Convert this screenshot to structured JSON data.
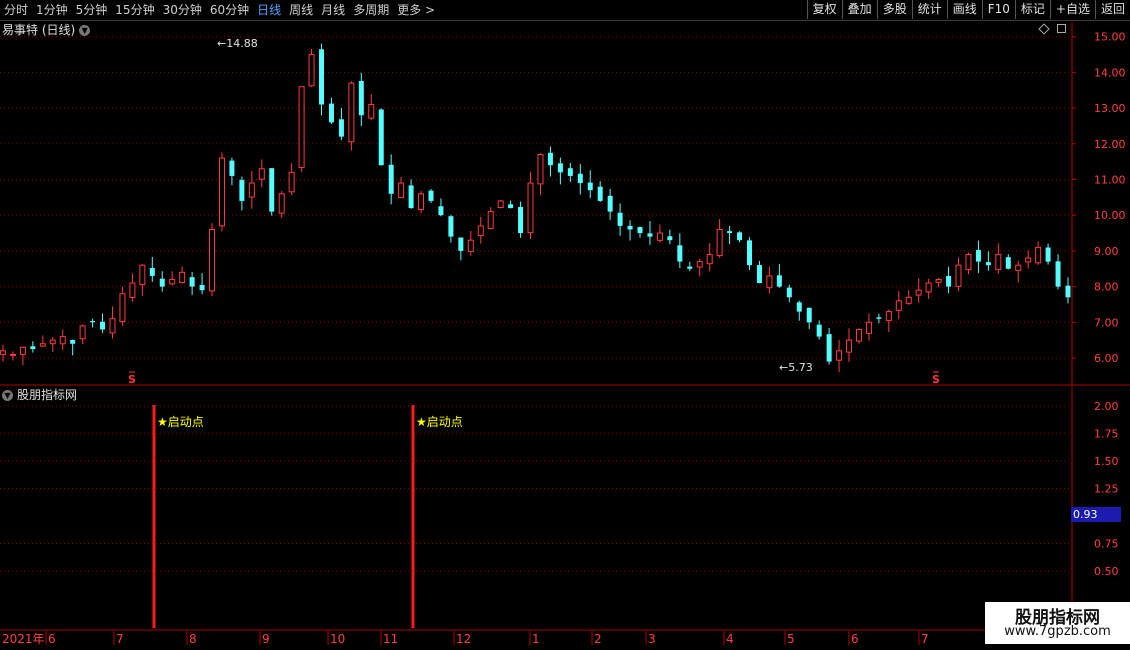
{
  "toolbar": {
    "periods": [
      "分时",
      "1分钟",
      "5分钟",
      "15分钟",
      "30分钟",
      "60分钟",
      "日线",
      "周线",
      "月线",
      "多周期",
      "更多 >"
    ],
    "active_period": "日线",
    "buttons": [
      "复权",
      "叠加",
      "多股",
      "统计",
      "画线",
      "F10",
      "标记",
      "+自选",
      "返回"
    ]
  },
  "chart": {
    "title": "易事特 (日线)",
    "high_label": "14.88",
    "low_label": "5.73",
    "signal_marks": [
      "S",
      "S"
    ]
  },
  "indicator": {
    "title": "股朋指标网",
    "signal_label": "★启动点",
    "current_value": "0.93"
  },
  "time_axis": {
    "year_label": "2021年",
    "months": [
      "6",
      "7",
      "8",
      "9",
      "10",
      "11",
      "12",
      "1",
      "2",
      "3",
      "4",
      "5",
      "6",
      "7"
    ]
  },
  "watermark": {
    "line1": "股朋指标网",
    "line2": "www.7gpzb.com"
  },
  "colors": {
    "up": "#ff3c3c",
    "down": "#55ffff",
    "grid": "#8b0000",
    "axis_text": "#ff4040",
    "signal_text": "#ffff00"
  },
  "chart_data": {
    "type": "candlestick",
    "main_ylim": [
      5.5,
      15.3
    ],
    "main_ticks": [
      6,
      7,
      8,
      9,
      10,
      11,
      12,
      13,
      14,
      15
    ],
    "indicator_ticks": [
      0.5,
      0.75,
      1.25,
      1.5,
      1.75,
      2.0
    ],
    "high": 14.88,
    "low": 5.73,
    "close_path": [
      6.2,
      6.1,
      6.3,
      6.25,
      6.4,
      6.5,
      6.6,
      6.4,
      6.9,
      7.0,
      6.8,
      7.1,
      7.8,
      8.1,
      8.6,
      8.3,
      8.0,
      8.2,
      8.4,
      8.0,
      7.9,
      9.6,
      11.6,
      11.1,
      10.4,
      10.9,
      11.3,
      10.1,
      10.6,
      11.2,
      13.6,
      14.5,
      13.1,
      12.6,
      12.2,
      13.7,
      12.8,
      13.1,
      11.4,
      10.6,
      10.9,
      10.2,
      10.6,
      10.4,
      10.0,
      9.4,
      9.0,
      9.3,
      9.7,
      10.1,
      10.4,
      10.2,
      9.5,
      10.9,
      11.7,
      11.4,
      11.2,
      11.1,
      10.9,
      10.7,
      10.4,
      10.1,
      9.7,
      9.6,
      9.5,
      9.4,
      9.5,
      9.3,
      8.7,
      8.5,
      8.7,
      8.9,
      9.6,
      9.5,
      9.3,
      8.6,
      8.1,
      8.3,
      8.0,
      7.7,
      7.3,
      7.0,
      6.6,
      5.9,
      6.2,
      6.5,
      6.8,
      7.0,
      7.1,
      7.3,
      7.6,
      7.7,
      7.9,
      8.1,
      8.2,
      8.0,
      8.6,
      8.9,
      8.7,
      8.6,
      8.9,
      8.5,
      8.6,
      8.8,
      9.1,
      8.7,
      8.0,
      7.7
    ]
  }
}
